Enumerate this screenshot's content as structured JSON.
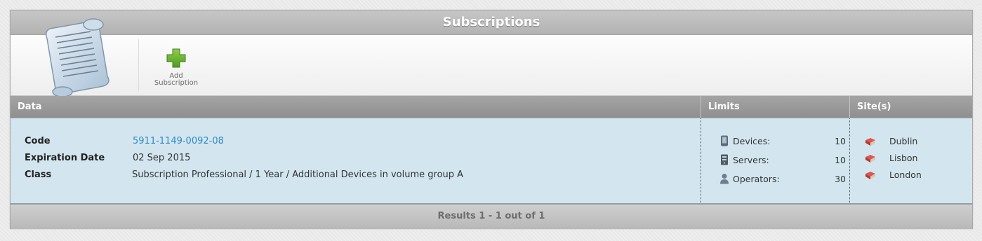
{
  "window": {
    "title": "Subscriptions"
  },
  "toolbar": {
    "logo_icon": "scroll-document-icon",
    "add_button": {
      "label": "Add\nSubscription",
      "icon": "green-plus-icon"
    }
  },
  "grid": {
    "columns": [
      "Data",
      "Limits",
      "Site(s)"
    ],
    "row": {
      "fields": [
        {
          "label": "Code",
          "value": "5911-1149-0092-08"
        },
        {
          "label": "Expiration Date",
          "value": "02 Sep 2015"
        },
        {
          "label": "Class",
          "value": "Subscription Professional / 1 Year / Additional Devices in volume group A"
        }
      ],
      "limits": [
        {
          "label": "Devices:",
          "value": "10",
          "icon": "device-icon"
        },
        {
          "label": "Servers:",
          "value": "10",
          "icon": "server-icon"
        },
        {
          "label": "Operators:",
          "value": "30",
          "icon": "operator-icon"
        }
      ],
      "sites": [
        {
          "name": "Dublin",
          "icon": "site-book-icon"
        },
        {
          "name": "Lisbon",
          "icon": "site-book-icon"
        },
        {
          "name": "London",
          "icon": "site-book-icon"
        }
      ]
    }
  },
  "footer": {
    "results_text": "Results 1 - 1 out of 1"
  },
  "colors": {
    "link": "#2f8ac4",
    "row_background": "#d3e6ef",
    "header_gray": "#9a9a9a",
    "title_gray": "#bdbdbd"
  }
}
